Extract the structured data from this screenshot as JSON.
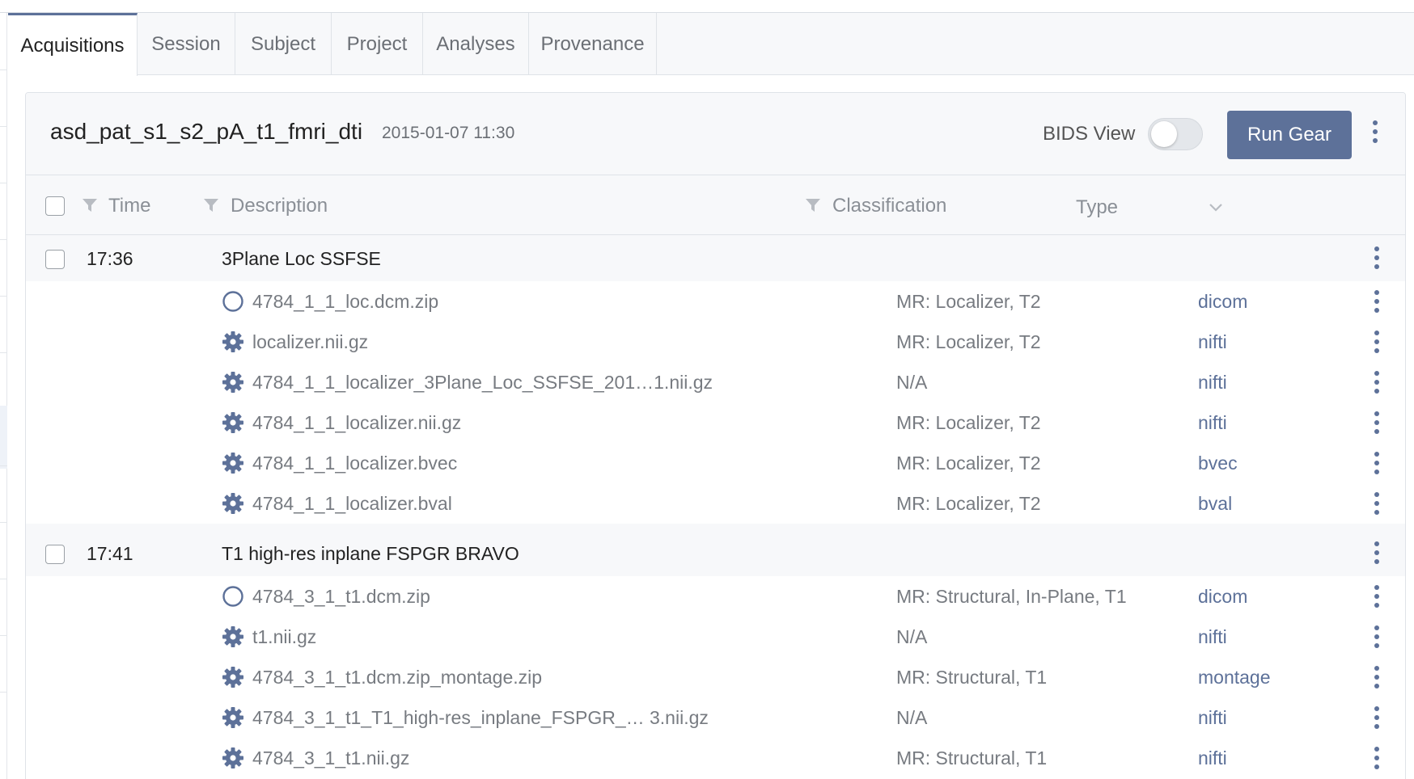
{
  "tabs": [
    {
      "label": "Acquisitions",
      "active": true
    },
    {
      "label": "Session",
      "active": false
    },
    {
      "label": "Subject",
      "active": false
    },
    {
      "label": "Project",
      "active": false
    },
    {
      "label": "Analyses",
      "active": false
    },
    {
      "label": "Provenance",
      "active": false
    }
  ],
  "header": {
    "title": "asd_pat_s1_s2_pA_t1_fmri_dti",
    "date": "2015-01-07 11:30",
    "bids_label": "BIDS View",
    "bids_enabled": false,
    "run_gear_label": "Run Gear"
  },
  "columns": {
    "time": "Time",
    "description": "Description",
    "classification": "Classification",
    "type": "Type"
  },
  "colors": {
    "accent": "#5d7199",
    "muted_text": "#777b81",
    "header_bg": "#f7f8fa"
  },
  "acquisitions": [
    {
      "time": "17:36",
      "description": "3Plane Loc SSFSE",
      "files": [
        {
          "icon": "circle-icon",
          "name": "4784_1_1_loc.dcm.zip",
          "classification": "MR: Localizer, T2",
          "type": "dicom"
        },
        {
          "icon": "gear-icon",
          "name": "localizer.nii.gz",
          "classification": "MR: Localizer, T2",
          "type": "nifti"
        },
        {
          "icon": "gear-icon",
          "name": "4784_1_1_localizer_3Plane_Loc_SSFSE_201…1.nii.gz",
          "classification": "N/A",
          "type": "nifti"
        },
        {
          "icon": "gear-icon",
          "name": "4784_1_1_localizer.nii.gz",
          "classification": "MR: Localizer, T2",
          "type": "nifti"
        },
        {
          "icon": "gear-icon",
          "name": "4784_1_1_localizer.bvec",
          "classification": "MR: Localizer, T2",
          "type": "bvec"
        },
        {
          "icon": "gear-icon",
          "name": "4784_1_1_localizer.bval",
          "classification": "MR: Localizer, T2",
          "type": "bval"
        }
      ]
    },
    {
      "time": "17:41",
      "description": "T1 high-res inplane FSPGR BRAVO",
      "files": [
        {
          "icon": "circle-icon",
          "name": "4784_3_1_t1.dcm.zip",
          "classification": "MR: Structural, In-Plane, T1",
          "type": "dicom"
        },
        {
          "icon": "gear-icon",
          "name": "t1.nii.gz",
          "classification": "N/A",
          "type": "nifti"
        },
        {
          "icon": "gear-icon",
          "name": "4784_3_1_t1.dcm.zip_montage.zip",
          "classification": "MR: Structural, T1",
          "type": "montage"
        },
        {
          "icon": "gear-icon",
          "name": "4784_3_1_t1_T1_high-res_inplane_FSPGR_…  3.nii.gz",
          "classification": "N/A",
          "type": "nifti"
        },
        {
          "icon": "gear-icon",
          "name": "4784_3_1_t1.nii.gz",
          "classification": "MR: Structural, T1",
          "type": "nifti"
        }
      ]
    }
  ]
}
